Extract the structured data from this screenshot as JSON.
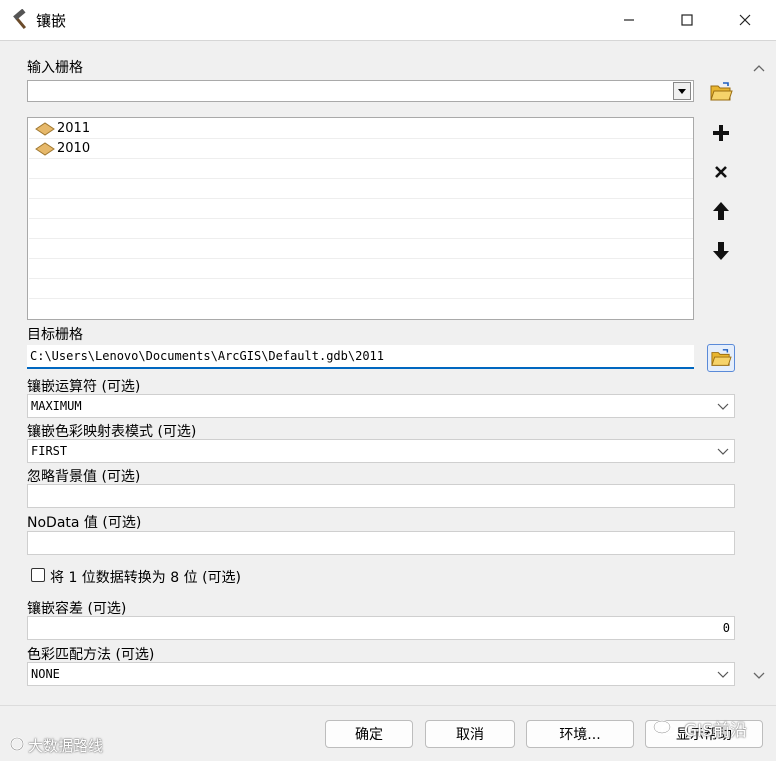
{
  "window": {
    "title": "镶嵌",
    "app_icon": "hammer-icon",
    "controls": [
      "minimize-icon",
      "maximize-icon",
      "close-icon"
    ]
  },
  "form": {
    "input_rasters_label": "输入栅格",
    "input_rasters_value": "",
    "input_rasters_list": [
      "2011",
      "2010"
    ],
    "target_raster_label": "目标栅格",
    "target_raster_value": "C:\\Users\\Lenovo\\Documents\\ArcGIS\\Default.gdb\\2011",
    "mosaic_operator_label": "镶嵌运算符 (可选)",
    "mosaic_operator_value": "MAXIMUM",
    "colormap_mode_label": "镶嵌色彩映射表模式 (可选)",
    "colormap_mode_value": "FIRST",
    "ignore_background_label": "忽略背景值 (可选)",
    "ignore_background_value": "",
    "nodata_label": "NoData 值 (可选)",
    "nodata_value": "",
    "convert_1bit_label": "将 1 位数据转换为 8 位 (可选)",
    "convert_1bit_checked": false,
    "tolerance_label": "镶嵌容差 (可选)",
    "tolerance_value": "0",
    "color_matching_label": "色彩匹配方法 (可选)",
    "color_matching_value": "NONE"
  },
  "buttons": {
    "ok": "确定",
    "cancel": "取消",
    "environments": "环境...",
    "help": "显示帮助"
  },
  "watermarks": {
    "left": "大数据路线",
    "right": "GIS前沿"
  },
  "colors": {
    "accent": "#0067c0",
    "folder": "#e8b530",
    "raster_icon": "#e6b86a"
  }
}
